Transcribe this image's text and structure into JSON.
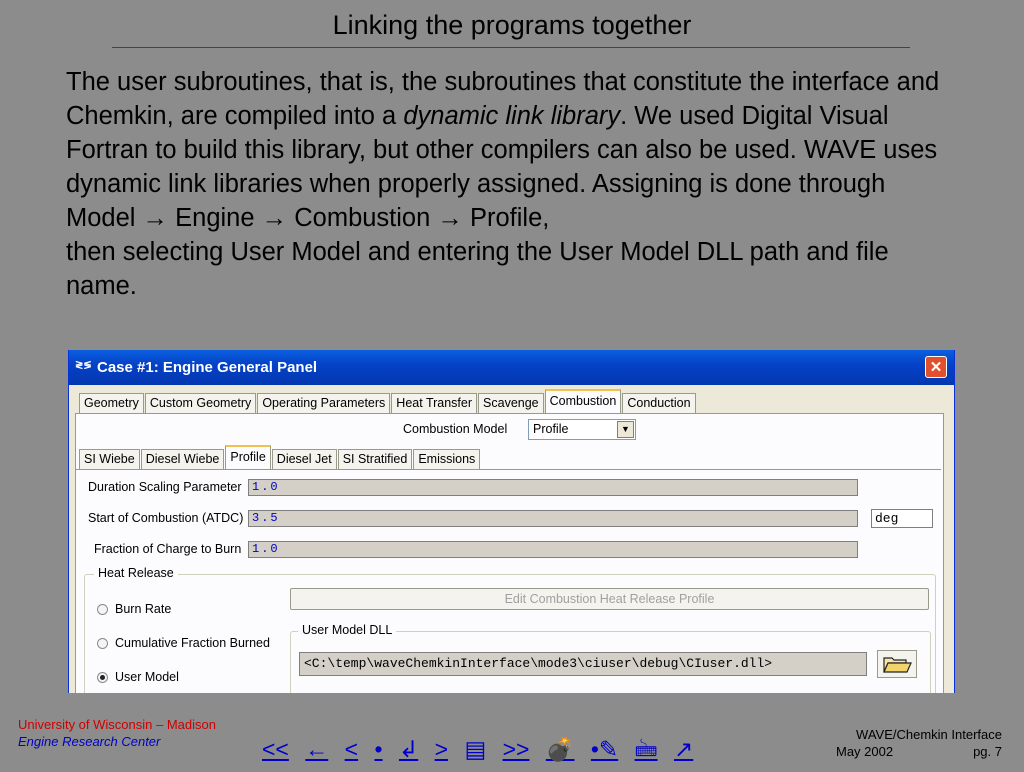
{
  "slide": {
    "title": "Linking the programs together",
    "para1_a": "The user subroutines, that is, the subroutines that constitute the interface and Chemkin, are compiled into a ",
    "para1_em": "dynamic link library",
    "para1_b": ".  We used Digital Visual Fortran to build this library, but other compilers can also be used.  WAVE uses dynamic link libraries when properly assigned.  Assigning is done through",
    "path": [
      "Model",
      "Engine",
      "Combustion",
      "Profile,"
    ],
    "arrow": "→",
    "para3": "then selecting User Model and entering the User Model DLL path and file name."
  },
  "window": {
    "icon": "≷≶",
    "title": "Case #1: Engine General Panel",
    "close": "✕",
    "top_tabs": [
      "Geometry",
      "Custom Geometry",
      "Operating Parameters",
      "Heat Transfer",
      "Scavenge",
      "Combustion",
      "Conduction"
    ],
    "combustion_model_label": "Combustion Model",
    "combustion_model_value": "Profile",
    "sub_tabs": [
      "SI Wiebe",
      "Diesel Wiebe",
      "Profile",
      "Diesel Jet",
      "SI Stratified",
      "Emissions"
    ],
    "fields": [
      {
        "label": "Duration Scaling Parameter",
        "value": "1.0"
      },
      {
        "label": "Start of Combustion (ATDC)",
        "value": "3.5",
        "unit": "deg"
      },
      {
        "label": "Fraction of Charge to Burn",
        "value": "1.0"
      }
    ],
    "heat_release": {
      "title": "Heat Release",
      "options": [
        "Burn Rate",
        "Cumulative Fraction Burned",
        "User Model"
      ],
      "selected": "User Model",
      "edit_button": "Edit Combustion Heat Release Profile",
      "dll_group_title": "User Model DLL",
      "dll_path": "<C:\\temp\\waveChemkinInterface\\mode3\\ciuser\\debug\\CIuser.dll>"
    }
  },
  "footer": {
    "university": "University of Wisconsin – Madison",
    "center": "Engine Research Center",
    "doc_title": "WAVE/Chemkin Interface",
    "date": "May 2002",
    "page": "pg. 7",
    "nav": [
      "<<",
      "←",
      "<",
      "•",
      "↲",
      ">",
      "▤",
      ">>",
      "💣",
      "•✎",
      "🖮",
      "↗"
    ]
  },
  "colors": {
    "background": "#8c8c8c",
    "title_rule": "#e00000",
    "nav_links": "#0000c8",
    "university": "#d00000",
    "titlebar": "#0542c7"
  }
}
